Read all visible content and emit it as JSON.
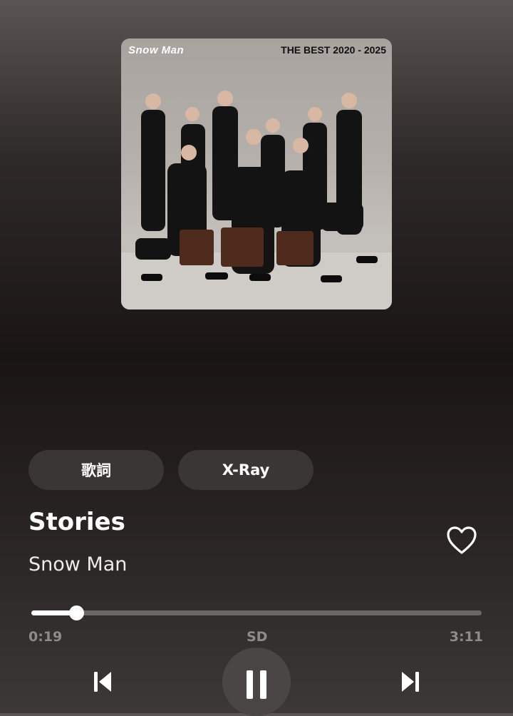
{
  "album": {
    "logo_text": "Snow Man",
    "title_text": "THE BEST 2020 - 2025"
  },
  "buttons": {
    "lyrics_label": "歌詞",
    "xray_label": "X-Ray"
  },
  "track": {
    "title": "Stories",
    "artist": "Snow Man",
    "favorited": false
  },
  "playback": {
    "elapsed": "0:19",
    "quality": "SD",
    "total": "3:11",
    "progress_fraction": 0.0995,
    "state": "playing"
  },
  "icons": {
    "heart": "heart-outline-icon",
    "previous": "skip-previous-icon",
    "pause": "pause-icon",
    "next": "skip-next-icon"
  },
  "colors": {
    "pill_bg": "#3a3636",
    "track_bg": "#6a6767",
    "track_fill": "#ffffff",
    "muted_text": "#8e8b8b"
  }
}
